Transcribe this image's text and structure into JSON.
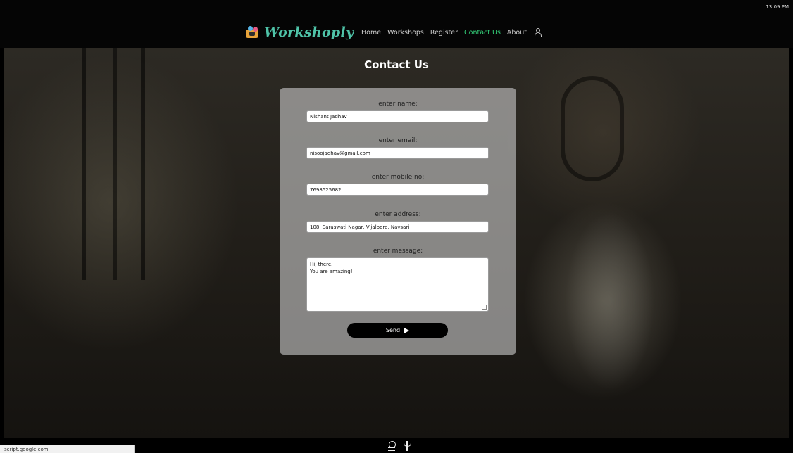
{
  "system": {
    "clock": "13:09 PM"
  },
  "brand": {
    "name": "Workshoply",
    "color": "#4fc3a8"
  },
  "nav": {
    "items": [
      "Home",
      "Workshops",
      "Register",
      "Contact Us",
      "About"
    ],
    "active": "Contact Us",
    "active_color": "#34d27a",
    "user_icon": "user-icon"
  },
  "page": {
    "title": "Contact Us"
  },
  "form": {
    "name": {
      "label": "enter name:",
      "value": "Nishant Jadhav"
    },
    "email": {
      "label": "enter email:",
      "value": "nisoojadhav@gmail.com"
    },
    "mobile": {
      "label": "enter mobile no:",
      "value": "7698525682"
    },
    "address": {
      "label": "enter address:",
      "value": "108, Saraswati Nagar, Vijalpore, Navsari"
    },
    "message": {
      "label": "enter message:",
      "line1": "Hi, there.",
      "line2": "You are amazing!"
    },
    "send_label": "Send"
  },
  "footer": {
    "icons": [
      "logo-icon",
      "brand-mark-icon"
    ]
  },
  "status_bar": {
    "url": "script.google.com"
  }
}
